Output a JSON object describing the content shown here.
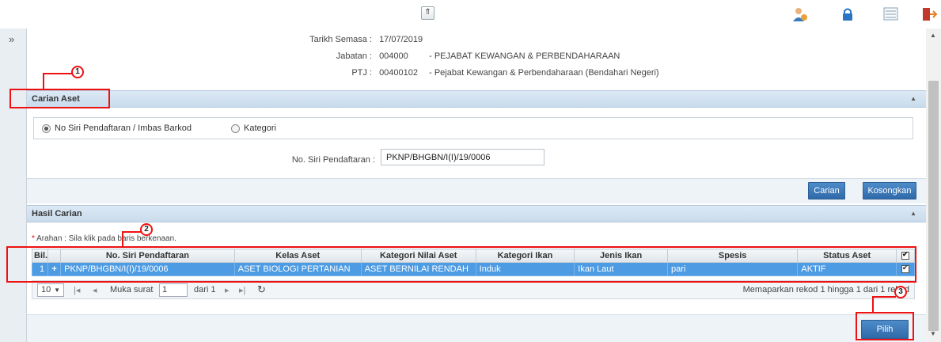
{
  "info": {
    "tarikh_label": "Tarikh Semasa :",
    "tarikh_value": "17/07/2019",
    "jabatan_label": "Jabatan :",
    "jabatan_code": "004000",
    "jabatan_name": "- PEJABAT KEWANGAN & PERBENDAHARAAN",
    "ptj_label": "PTJ :",
    "ptj_code": "00400102",
    "ptj_name": "- Pejabat Kewangan & Perbendaharaan (Bendahari Negeri)"
  },
  "carian": {
    "title": "Carian Aset",
    "option1": "No Siri Pendaftaran / Imbas Barkod",
    "option2": "Kategori",
    "field_label": "No. Siri Pendaftaran :",
    "field_value": "PKNP/BHGBN/I(I)/19/0006",
    "btn_search": "Carian",
    "btn_clear": "Kosongkan"
  },
  "hasil": {
    "title": "Hasil Carian",
    "hint_star": "*",
    "hint_text": " Arahan : Sila klik pada baris berkenaan.",
    "columns": [
      "Bil.",
      "No. Siri Pendaftaran",
      "Kelas Aset",
      "Kategori Nilai Aset",
      "Kategori Ikan",
      "Jenis Ikan",
      "Spesis",
      "Status Aset"
    ],
    "rows": [
      {
        "bil": "1",
        "no_siri": "PKNP/BHGBN/I(I)/19/0006",
        "kelas": "ASET BIOLOGI PERTANIAN",
        "kategori_nilai": "ASET BERNILAI RENDAH",
        "kategori_ikan": "Induk",
        "jenis_ikan": "Ikan Laut",
        "spesis": "pari",
        "status": "AKTIF"
      }
    ]
  },
  "pager": {
    "page_size": "10",
    "muka_surat_label": "Muka surat",
    "page_value": "1",
    "dari_label": "dari 1",
    "summary": "Memaparkan rekod 1 hingga 1 dari 1 rekod"
  },
  "footer": {
    "btn_pilih": "Pilih"
  },
  "annotations": {
    "a1": "1",
    "a2": "2",
    "a3": "3"
  },
  "colors": {
    "accent": "#2f6aa8",
    "selected_row": "#4d9be3",
    "annotation": "#e11111"
  }
}
